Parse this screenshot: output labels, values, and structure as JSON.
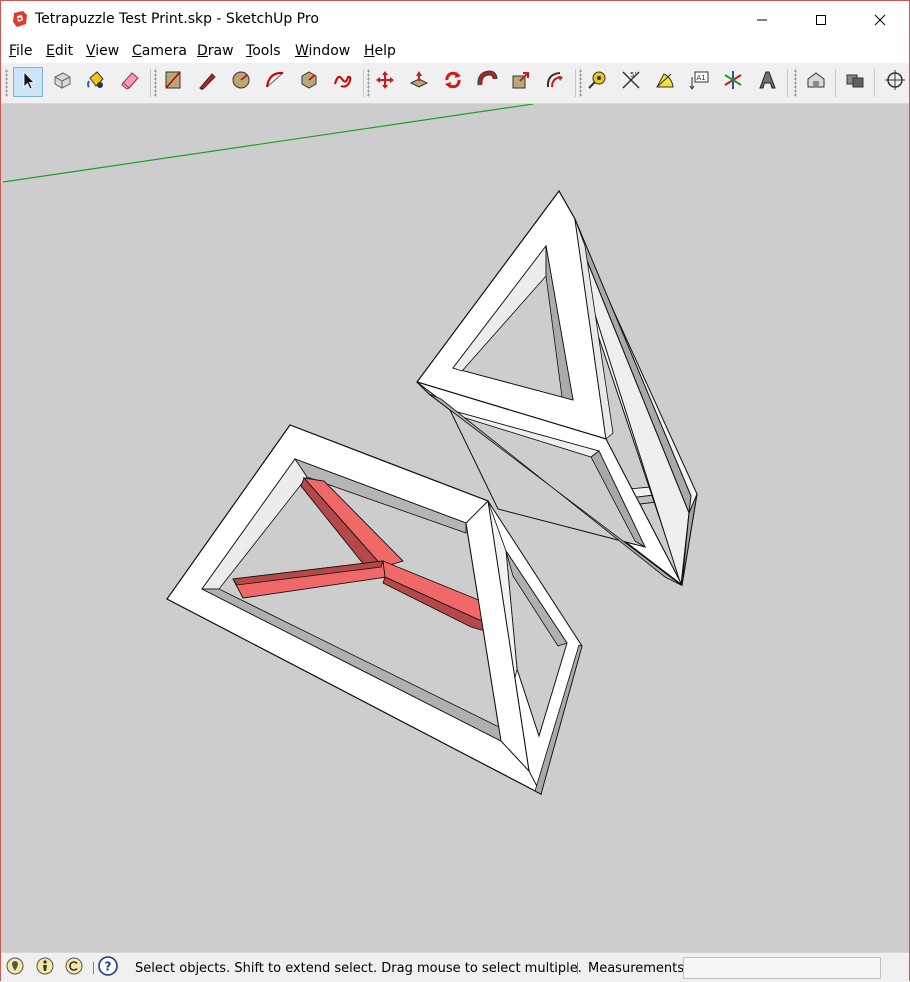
{
  "window": {
    "title": "Tetrapuzzle Test Print.skp - SketchUp Pro",
    "controls": [
      "minimize-icon",
      "maximize-icon",
      "close-icon"
    ]
  },
  "menu": {
    "items": [
      {
        "mnemonic": "F",
        "rest": "ile"
      },
      {
        "mnemonic": "E",
        "rest": "dit"
      },
      {
        "mnemonic": "V",
        "rest": "iew"
      },
      {
        "mnemonic": "C",
        "rest": "amera"
      },
      {
        "mnemonic": "D",
        "rest": "raw"
      },
      {
        "mnemonic": "T",
        "rest": "ools"
      },
      {
        "mnemonic": "W",
        "rest": "indow"
      },
      {
        "mnemonic": "H",
        "rest": "elp"
      }
    ]
  },
  "toolbar": {
    "active_tool": "select",
    "tools": [
      "select-icon",
      "make-component-icon",
      "paint-bucket-icon",
      "eraser-icon",
      "rectangle-icon",
      "line-icon",
      "circle-icon",
      "arc-icon",
      "polygon-icon",
      "freehand-icon",
      "move-icon",
      "push-pull-icon",
      "rotate-icon",
      "follow-me-icon",
      "scale-icon",
      "offset-icon",
      "tape-measure-icon",
      "dimension-icon",
      "protractor-icon",
      "text-icon",
      "axes-icon",
      "3d-text-icon",
      "warehouse-icon",
      "extension-warehouse-icon",
      "orbit-icon"
    ]
  },
  "viewport": {
    "background": "#cdcdcd",
    "green_axis_color": "#22a022",
    "face_color": "#ffffff",
    "side_color": "#a8a8a8",
    "highlight_color": "#f06464"
  },
  "statusbar": {
    "icons": [
      "geolocation-icon",
      "credits-icon",
      "copyright-icon",
      "help-icon"
    ],
    "message": "Select objects. Shift to extend select. Drag mouse to select multiple.",
    "measurements_label": "Measurements",
    "measurements_value": ""
  }
}
